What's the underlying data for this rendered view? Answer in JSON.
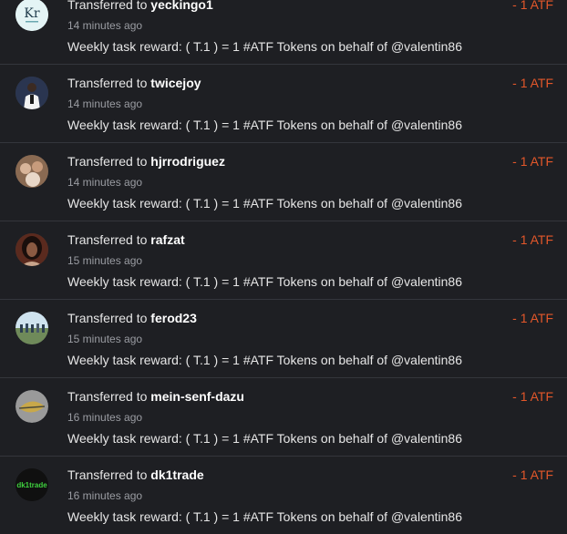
{
  "transfers": [
    {
      "prefix": "Transferred to",
      "user": "yeckingo1",
      "time": "14 minutes ago",
      "memo": "Weekly task reward: ( T.1 ) = 1 #ATF Tokens on behalf of @valentin86",
      "amount": "- 1 ATF",
      "avatar": "kr-logo-avatar",
      "avatar_text": "Kr"
    },
    {
      "prefix": "Transferred to",
      "user": "twicejoy",
      "time": "14 minutes ago",
      "memo": "Weekly task reward: ( T.1 ) = 1 #ATF Tokens on behalf of @valentin86",
      "amount": "- 1 ATF",
      "avatar": "person-photo-avatar"
    },
    {
      "prefix": "Transferred to",
      "user": "hjrrodriguez",
      "time": "14 minutes ago",
      "memo": "Weekly task reward: ( T.1 ) = 1 #ATF Tokens on behalf of @valentin86",
      "amount": "- 1 ATF",
      "avatar": "group-photo-avatar"
    },
    {
      "prefix": "Transferred to",
      "user": "rafzat",
      "time": "15 minutes ago",
      "memo": "Weekly task reward: ( T.1 ) = 1 #ATF Tokens on behalf of @valentin86",
      "amount": "- 1 ATF",
      "avatar": "portrait-photo-avatar"
    },
    {
      "prefix": "Transferred to",
      "user": "ferod23",
      "time": "15 minutes ago",
      "memo": "Weekly task reward: ( T.1 ) = 1 #ATF Tokens on behalf of @valentin86",
      "amount": "- 1 ATF",
      "avatar": "outdoor-group-photo-avatar"
    },
    {
      "prefix": "Transferred to",
      "user": "mein-senf-dazu",
      "time": "16 minutes ago",
      "memo": "Weekly task reward: ( T.1 ) = 1 #ATF Tokens on behalf of @valentin86",
      "amount": "- 1 ATF",
      "avatar": "leaf-emblem-avatar"
    },
    {
      "prefix": "Transferred to",
      "user": "dk1trade",
      "time": "16 minutes ago",
      "memo": "Weekly task reward: ( T.1 ) = 1 #ATF Tokens on behalf of @valentin86",
      "amount": "- 1 ATF",
      "avatar": "dk1trade-logo-avatar",
      "avatar_text": "dk1trade"
    }
  ],
  "colors": {
    "background": "#1e1f23",
    "divider": "#34363c",
    "amount": "#e3572a",
    "text": "#e6e6e6",
    "muted": "#9a9ca2"
  }
}
